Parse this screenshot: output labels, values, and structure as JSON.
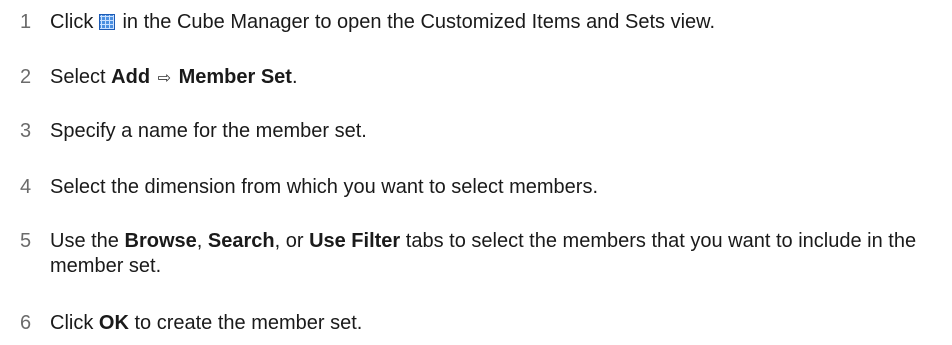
{
  "steps": [
    {
      "number": "1",
      "pre": "Click",
      "icon": "cube-grid-icon",
      "post": "in the Cube Manager to open the Customized Items and Sets view."
    },
    {
      "number": "2",
      "pre": "Select",
      "bold1": "Add",
      "arrow": "⇨",
      "bold2": "Member Set",
      "post": "."
    },
    {
      "number": "3",
      "text": "Specify a name for the member set."
    },
    {
      "number": "4",
      "text": "Select the dimension from which you want to select members."
    },
    {
      "number": "5",
      "pre": "Use the",
      "bold1": "Browse",
      "sep1": ",",
      "bold2": "Search",
      "sep2": ", or",
      "bold3": "Use Filter",
      "post": "tabs to select the members that you want to include in the member set."
    },
    {
      "number": "6",
      "pre": "Click",
      "bold1": "OK",
      "post": "to create the member set."
    }
  ],
  "colors": {
    "number": "#6b6b6b",
    "text": "#1a1a1a",
    "icon": "#4a8fe0"
  }
}
